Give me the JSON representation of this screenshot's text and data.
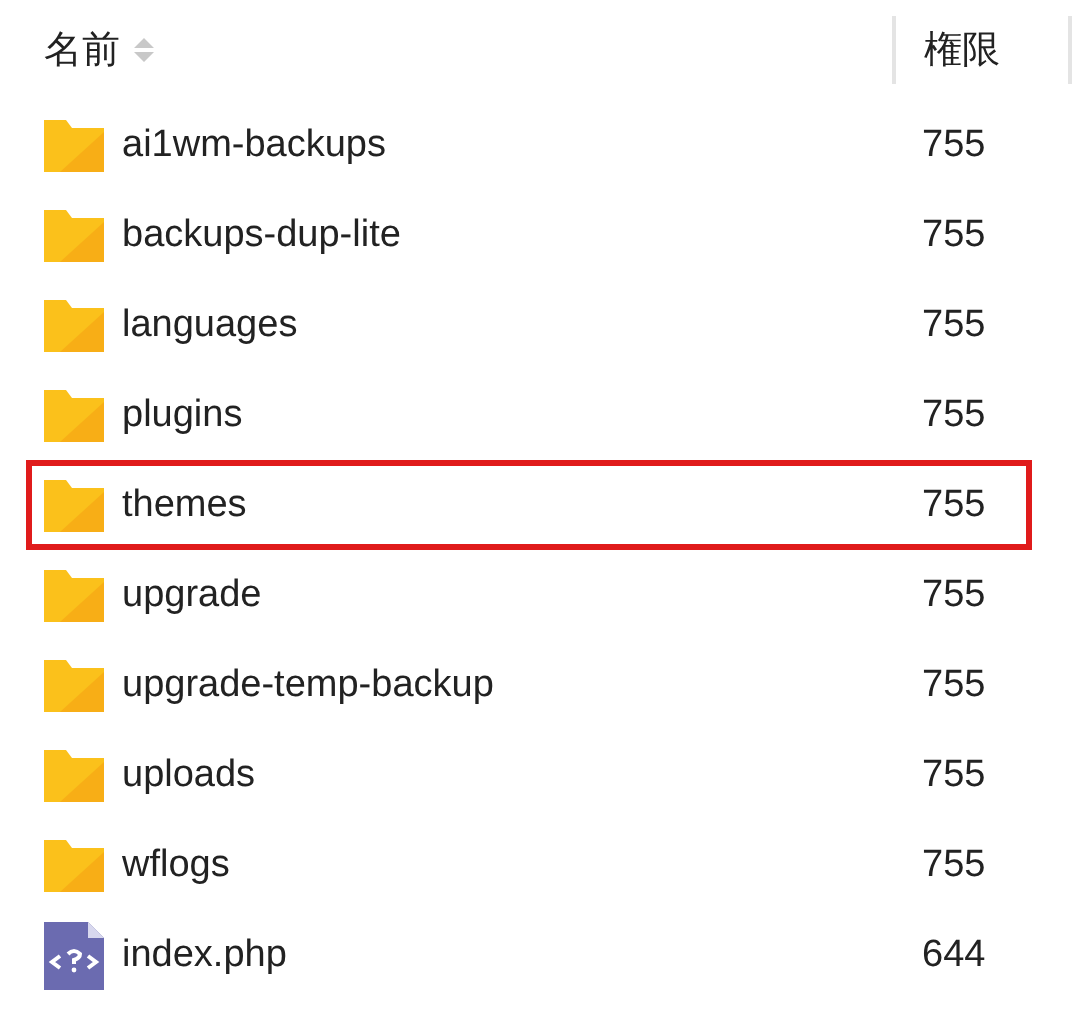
{
  "table": {
    "columns": [
      {
        "label": "名前",
        "sortable": true
      },
      {
        "label": "権限",
        "sortable": false
      }
    ],
    "rows": [
      {
        "kind": "folder",
        "name": "ai1wm-backups",
        "permission": "755",
        "highlighted": false
      },
      {
        "kind": "folder",
        "name": "backups-dup-lite",
        "permission": "755",
        "highlighted": false
      },
      {
        "kind": "folder",
        "name": "languages",
        "permission": "755",
        "highlighted": false
      },
      {
        "kind": "folder",
        "name": "plugins",
        "permission": "755",
        "highlighted": false
      },
      {
        "kind": "folder",
        "name": "themes",
        "permission": "755",
        "highlighted": true
      },
      {
        "kind": "folder",
        "name": "upgrade",
        "permission": "755",
        "highlighted": false
      },
      {
        "kind": "folder",
        "name": "upgrade-temp-backup",
        "permission": "755",
        "highlighted": false
      },
      {
        "kind": "folder",
        "name": "uploads",
        "permission": "755",
        "highlighted": false
      },
      {
        "kind": "folder",
        "name": "wflogs",
        "permission": "755",
        "highlighted": false
      },
      {
        "kind": "php",
        "name": "index.php",
        "permission": "644",
        "highlighted": false
      }
    ]
  }
}
